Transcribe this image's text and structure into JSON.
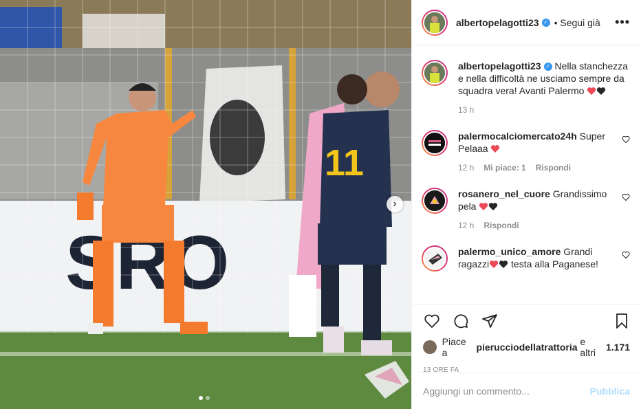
{
  "post": {
    "author": "albertopelagotti23",
    "follow_status": "• Segui già",
    "more": "•••",
    "caption_line1": "Nella stanchezza e nella difficoltà ne usciamo sempre da squadra vera!",
    "caption_line2": "Avanti Palermo",
    "caption_time": "13 h"
  },
  "photo": {
    "banner_text": "SRO",
    "player_number": "11",
    "slides_total": 2,
    "slide_current": 1
  },
  "comments": [
    {
      "user": "palermocalciomercato24h",
      "text": "Super Pelaaa",
      "time": "12 h",
      "likes": "Mi piace: 1",
      "reply": "Rispondi",
      "hearts": [
        "red"
      ]
    },
    {
      "user": "rosanero_nel_cuore",
      "text": "Grandissimo pela",
      "time": "12 h",
      "reply": "Rispondi",
      "hearts": [
        "red",
        "black"
      ]
    },
    {
      "user": "palermo_unico_amore",
      "text_before": "Grandi ragazzi",
      "text_after": "testa alla Paganese!",
      "hearts": [
        "red",
        "black"
      ]
    }
  ],
  "likes": {
    "prefix": "Piace a",
    "user": "pierucciodellatrattoria",
    "suffix": "e altri",
    "count": "1.171"
  },
  "posted_ago": "13 ORE FA",
  "add_comment": {
    "placeholder": "Aggiungi un commento...",
    "publish": "Pubblica"
  },
  "colors": {
    "accent": "#3897f0",
    "publish_disabled": "#b2dffc",
    "heart_red": "#ed4956",
    "keeper_kit": "#f7873f"
  }
}
